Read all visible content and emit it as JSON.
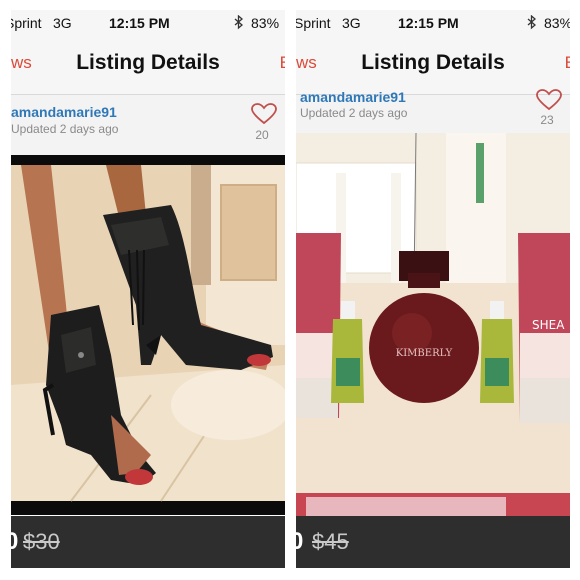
{
  "screens": [
    {
      "status": {
        "carrier": "Sprint",
        "network": "3G",
        "time": "12:15 PM",
        "battery": "83%",
        "bluetooth_icon": "bluetooth-icon"
      },
      "nav": {
        "back_partial": "ws",
        "title": "Listing Details",
        "edge_partial": "E"
      },
      "seller": {
        "username": "amandamarie91",
        "updated": "Updated 2 days ago"
      },
      "likes": {
        "count": "20",
        "icon": "heart-icon"
      },
      "listing": {
        "photo": "black fringe peep-toe ankle booties",
        "price_partial": "0",
        "original_price": "$30"
      }
    },
    {
      "status": {
        "carrier": "Sprint",
        "network": "3G",
        "time": "12:15 PM",
        "battery": "83%",
        "bluetooth_icon": "bluetooth-icon"
      },
      "nav": {
        "back_partial": "ws",
        "title": "Listing Details",
        "edge_partial": "E"
      },
      "seller": {
        "username": "amandamarie91",
        "updated": "Updated 2 days ago"
      },
      "likes": {
        "count": "23",
        "icon": "heart-icon"
      },
      "listing": {
        "photo": "Kimberly perfume with shea cashmere hand creams and hand sanitizers",
        "product_text": "KIMBERLY",
        "cream_text": "SHEA",
        "price_partial": "0",
        "original_price": "$45"
      }
    }
  ]
}
